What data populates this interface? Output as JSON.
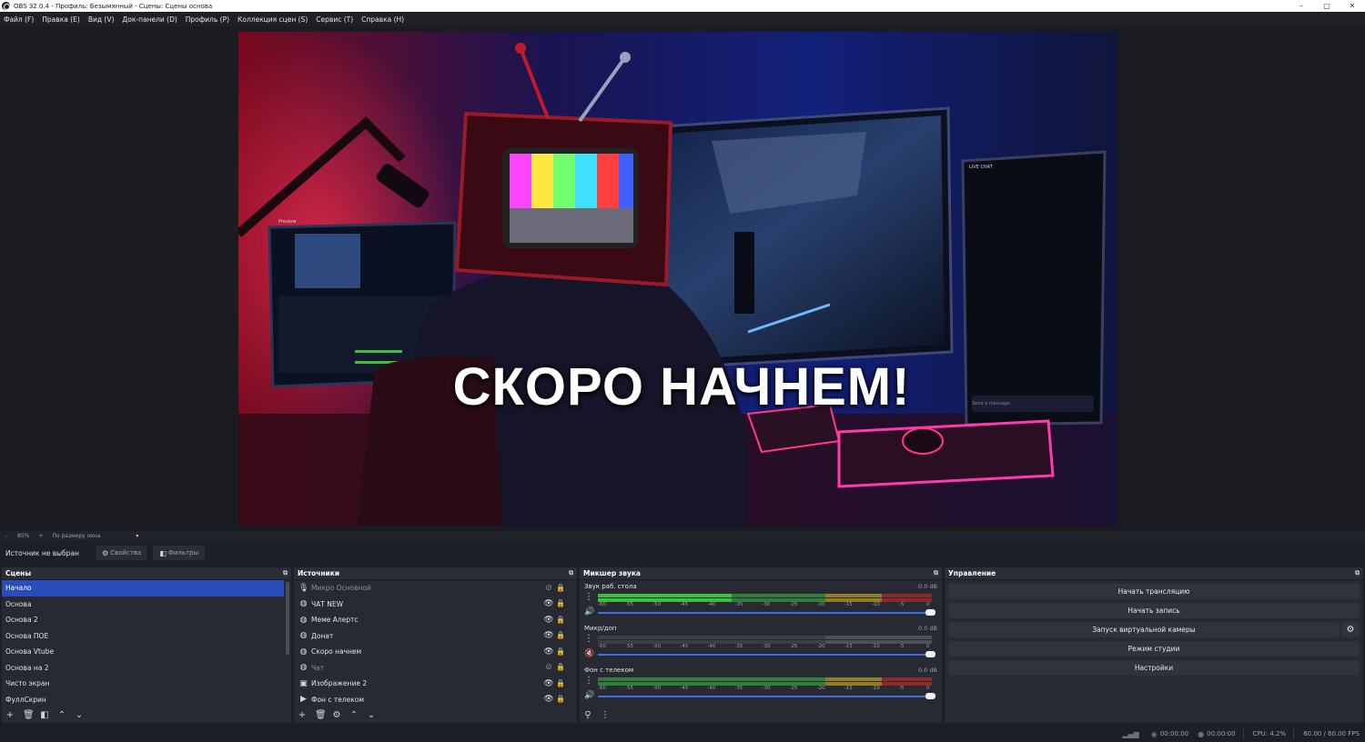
{
  "window": {
    "title": "OBS 32.0.4 - Профиль: Безымянный - Сцены: Сцены основа",
    "controls": [
      "–",
      "▢",
      "✕"
    ]
  },
  "menu": [
    "Файл (F)",
    "Правка (E)",
    "Вид (V)",
    "Док-панели (D)",
    "Профиль (P)",
    "Коллекция сцен (S)",
    "Сервис (T)",
    "Справка (H)"
  ],
  "preview": {
    "headline": "СКОРО НАЧНЕМ!",
    "mini_preview_label": "Preview",
    "live_chat_label": "LIVE CHAT",
    "chat_placeholder": "Send a message..."
  },
  "zoom": {
    "minus": "–",
    "value": "85%",
    "plus": "+",
    "mode": "По размеру окна",
    "arrow": "▾"
  },
  "source_toolbar": {
    "no_source": "Источник не выбран",
    "properties": "Свойства",
    "filters": "Фильтры"
  },
  "scenes": {
    "title": "Сцены",
    "items": [
      "Начало",
      "Основа",
      "Основа 2",
      "Основа ПОЕ",
      "Основа Vtube",
      "Основа на 2",
      "Чисто экран",
      "ФуллСкрин"
    ]
  },
  "sources": {
    "title": "Источники",
    "items": [
      {
        "label": "Микро Основной",
        "icon": "mic-icon",
        "glyph": "🎙",
        "visible": false
      },
      {
        "label": "ЧАТ NEW",
        "icon": "browser-icon",
        "glyph": "◍",
        "visible": true
      },
      {
        "label": "Меме Алертс",
        "icon": "browser-icon",
        "glyph": "◍",
        "visible": true
      },
      {
        "label": "Донат",
        "icon": "browser-icon",
        "glyph": "◍",
        "visible": true
      },
      {
        "label": "Скоро начнем",
        "icon": "browser-icon",
        "glyph": "◍",
        "visible": true
      },
      {
        "label": "Чат",
        "icon": "browser-icon",
        "glyph": "◍",
        "visible": false
      },
      {
        "label": "Изображение 2",
        "icon": "image-icon",
        "glyph": "▣",
        "visible": true
      },
      {
        "label": "Фон с телеком",
        "icon": "media-icon",
        "glyph": "▶",
        "visible": true
      }
    ]
  },
  "mixer": {
    "title": "Микшер звука",
    "scale": [
      "-60",
      "-55",
      "-50",
      "-45",
      "-40",
      "-35",
      "-30",
      "-25",
      "-20",
      "-15",
      "-10",
      "-5",
      "0"
    ],
    "channels": [
      {
        "name": "Звук раб. стола",
        "db": "0.0 dB",
        "muted": false,
        "active": true,
        "level": 0.4
      },
      {
        "name": "Микр/доп",
        "db": "0.0 dB",
        "muted": true,
        "active": false,
        "level": 0
      },
      {
        "name": "Фон с телеком",
        "db": "0.0 dB",
        "muted": false,
        "active": true,
        "level": 0
      }
    ]
  },
  "controls": {
    "title": "Управление",
    "start_stream": "Начать трансляцию",
    "start_record": "Начать запись",
    "virtual_cam": "Запуск виртуальной камеры",
    "studio_mode": "Режим студии",
    "settings": "Настройки"
  },
  "status": {
    "stream_time": "00:00:00",
    "record_time": "00:00:00",
    "cpu": "CPU: 4.2%",
    "fps": "60.00 / 60.00 FPS"
  },
  "colors": {
    "accent": "#284cb8",
    "meter_green": "#3fbf3f",
    "meter_yellow": "#b79a22",
    "meter_red": "#b22a2a",
    "fader": "#3d6ee6"
  }
}
